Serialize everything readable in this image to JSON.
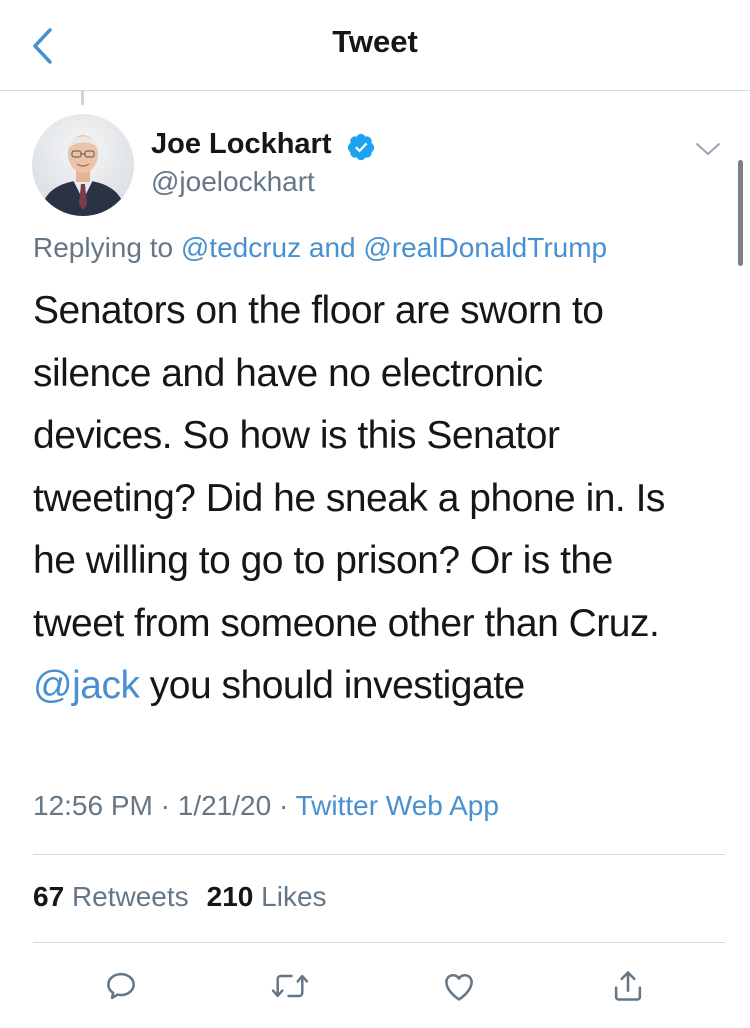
{
  "nav": {
    "title": "Tweet",
    "back_icon": "chevron-left-icon"
  },
  "author": {
    "name": "Joe Lockhart",
    "handle": "@joelockhart",
    "verified_icon": "verified-badge-icon"
  },
  "reply": {
    "prefix": "Replying to ",
    "mention1": "@tedcruz",
    "conjunction": " and ",
    "mention2": "@realDonaldTrump"
  },
  "tweet": {
    "lines": [
      "Senators on the floor are sworn to",
      "silence and have no electronic",
      "devices.  So how is this Senator",
      "tweeting?  Did he sneak a phone in.  Is",
      "he willing to go to prison?  Or is the",
      "tweet from someone other than Cruz."
    ],
    "last_mention": "@jack",
    "last_text": " you should investigate"
  },
  "meta": {
    "time": "12:56 PM",
    "separator": " · ",
    "date": "1/21/20",
    "source": "Twitter Web App"
  },
  "stats": {
    "retweets_count": "67",
    "retweets_label": "Retweets",
    "likes_count": "210",
    "likes_label": "Likes"
  },
  "actions": [
    "reply-icon",
    "retweet-icon",
    "like-icon",
    "share-icon"
  ],
  "colors": {
    "accent": "#4a90d0",
    "text": "#14171a",
    "secondary": "#657786",
    "divider": "#d6dbe0"
  }
}
